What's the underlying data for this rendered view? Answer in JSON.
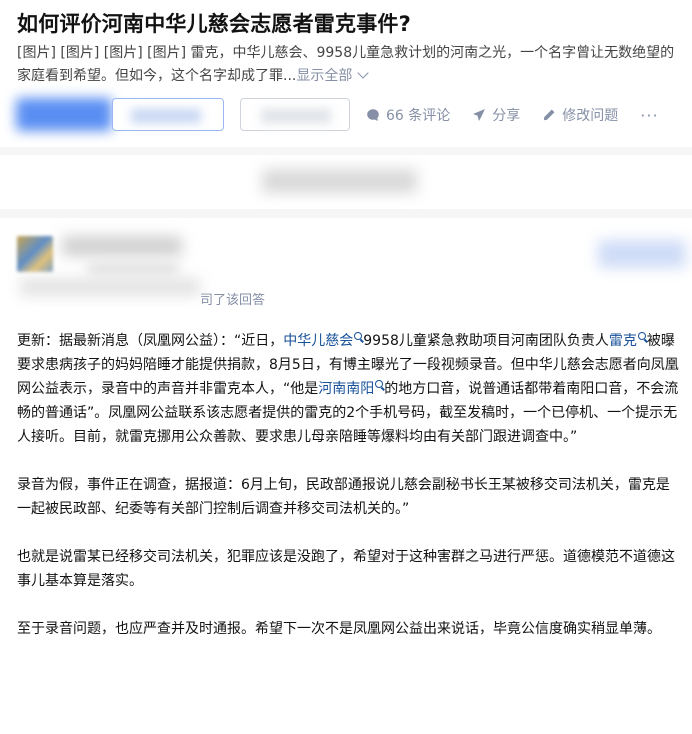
{
  "question": {
    "title": "如何评价河南中华儿慈会志愿者雷克事件?",
    "excerpt": "[图片] [图片] [图片] [图片] 雷克，中华儿慈会、9958儿童急救计划的河南之光，一个名字曾让无数绝望的家庭看到希望。但如今，这个名字却成了罪...",
    "show_all": "显示全部"
  },
  "actions": {
    "comments": "66 条评论",
    "share": "分享",
    "edit": "修改问题",
    "more": "···"
  },
  "icons": {
    "comment": "comment-icon",
    "share": "share-icon",
    "edit": "pencil-icon",
    "expand": "chevron-down-icon"
  },
  "colors": {
    "link": "#175199",
    "muted": "#8590a6",
    "primary": "#3d7bf0"
  },
  "answer": {
    "agree_suffix": "司了该回答",
    "p1": {
      "t1": "更新：据最新消息（凤凰网公益）：“近日，",
      "l1": "中华儿慈会",
      "t2": "9958儿童紧急救助项目河南团队负责人",
      "l2": "雷克",
      "t3": "被曝要求患病孩子的妈妈陪睡才能提供捐款，8月5日，有博主曝光了一段视频录音。但中华儿慈会志愿者向凤凰网公益表示，录音中的声音并非雷克本人，“他是",
      "l3": "河南南阳",
      "t4": "的地方口音，说普通话都带着南阳口音，不会流畅的普通话”。凤凰网公益联系该志愿者提供的雷克的2个手机号码，截至发稿时，一个已停机、一个提示无人接听。目前，就雷克挪用公众善款、要求患儿母亲陪睡等爆料均由有关部门跟进调查中。”"
    },
    "p2": "录音为假，事件正在调查，据报道：6月上旬，民政部通报说儿慈会副秘书长王某被移交司法机关，雷克是一起被民政部、纪委等有关部门控制后调查并移交司法机关的。”",
    "p3": "也就是说雷某已经移交司法机关，犯罪应该是没跑了，希望对于这种害群之马进行严惩。道德模范不道德这事儿基本算是落实。",
    "p4": "至于录音问题，也应严查并及时通报。希望下一次不是凤凰网公益出来说话，毕竟公信度确实稍显单薄。"
  }
}
